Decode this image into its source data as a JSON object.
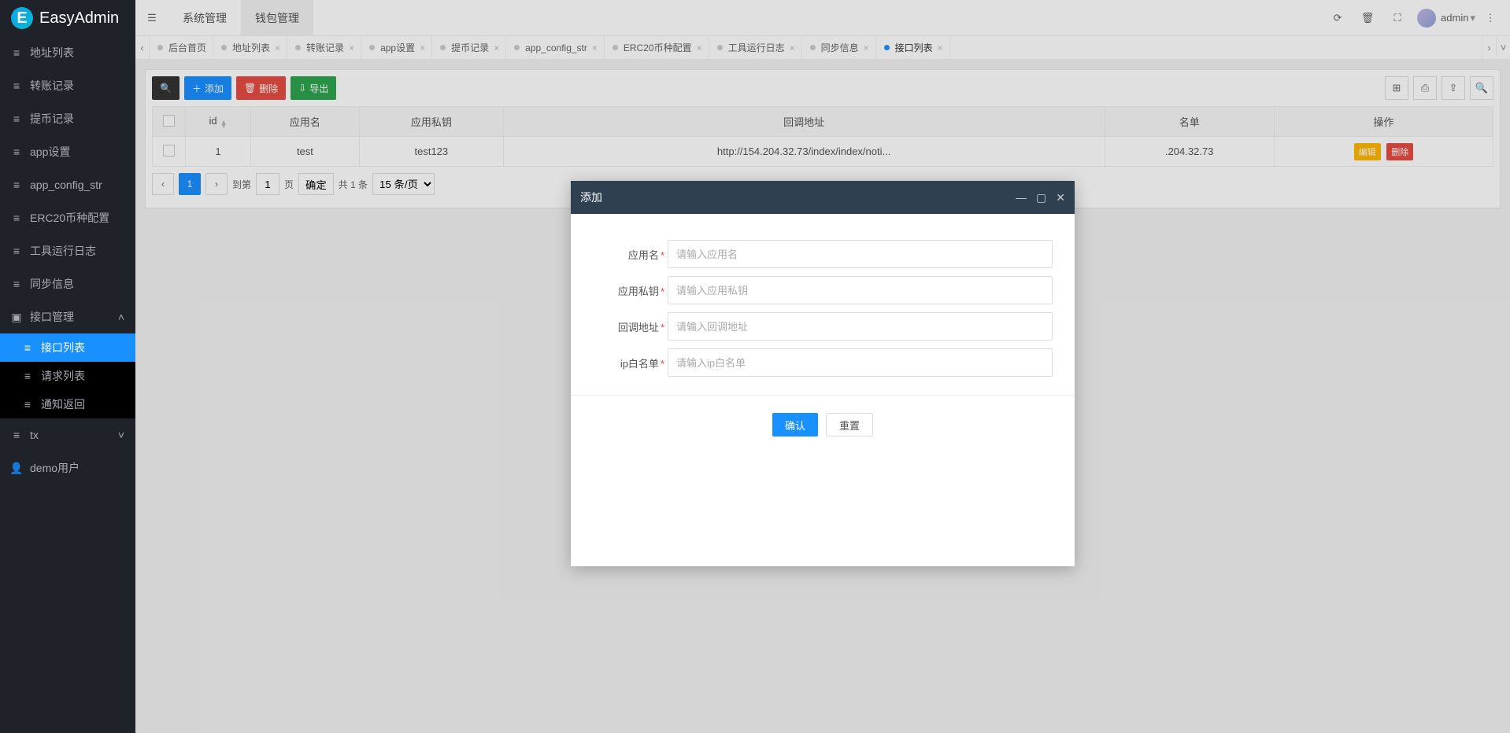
{
  "brand": "EasyAdmin",
  "topnav": {
    "tabs": [
      "系统管理",
      "钱包管理"
    ],
    "active_index": 1
  },
  "user": {
    "name": "admin"
  },
  "sidebar": {
    "items": [
      "地址列表",
      "转账记录",
      "提币记录",
      "app设置",
      "app_config_str",
      "ERC20币种配置",
      "工具运行日志",
      "同步信息"
    ],
    "group_api": {
      "label": "接口管理",
      "children": [
        "接口列表",
        "请求列表",
        "通知返回"
      ],
      "active_child_index": 0
    },
    "group_tx": {
      "label": "tx"
    },
    "demo_user": "demo用户"
  },
  "page_tabs": {
    "items": [
      "后台首页",
      "地址列表",
      "转账记录",
      "app设置",
      "提币记录",
      "app_config_str",
      "ERC20币种配置",
      "工具运行日志",
      "同步信息",
      "接口列表"
    ],
    "active_index": 9
  },
  "toolbar": {
    "add": "添加",
    "del": "删除",
    "export": "导出"
  },
  "table": {
    "headers": [
      "id",
      "应用名",
      "应用私钥",
      "回调地址",
      "名单",
      "操作"
    ],
    "rows": [
      {
        "id": "1",
        "app_name": "test",
        "app_secret": "test123",
        "callback": "http://154.204.32.73/index/index/noti...",
        "whitelist": ".204.32.73"
      }
    ],
    "row_actions": {
      "edit": "编辑",
      "del": "删除"
    }
  },
  "pager": {
    "page": "1",
    "goto_label": "到第",
    "page_unit": "页",
    "goto_btn": "确定",
    "total": "共 1 条",
    "page_size": "15 条/页"
  },
  "modal": {
    "title": "添加",
    "fields": {
      "app_name": {
        "label": "应用名",
        "placeholder": "请输入应用名",
        "required": true
      },
      "app_secret": {
        "label": "应用私钥",
        "placeholder": "请输入应用私钥",
        "required": true
      },
      "callback": {
        "label": "回调地址",
        "placeholder": "请输入回调地址",
        "required": true
      },
      "whitelist": {
        "label": "ip白名单",
        "placeholder": "请输入ip白名单",
        "required": true
      }
    },
    "confirm": "确认",
    "reset": "重置"
  }
}
